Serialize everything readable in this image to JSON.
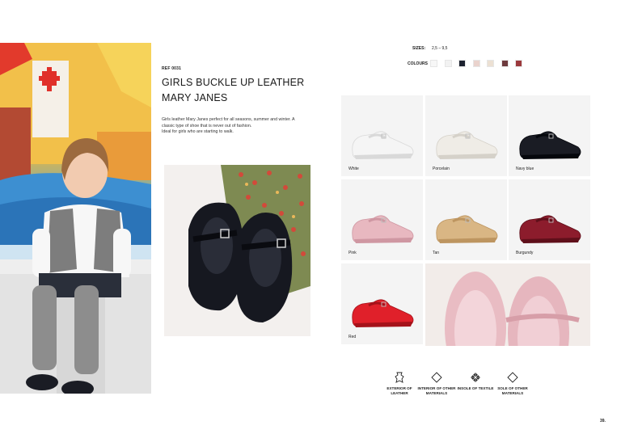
{
  "product": {
    "ref": "REF 0031",
    "title_line1": "GIRLS BUCKLE UP LEATHER",
    "title_line2": "MARY JANES",
    "description_line1": "Girls leather Mary Janes perfect for all seasons, summer and winter. A",
    "description_line2": "classic type of shoe that is never out of fashion.",
    "description_line3": "Ideal for girls who are starting to walk."
  },
  "specs": {
    "sizes_label": "SIZES:",
    "sizes_value": "2,5 – 9,5",
    "colours_label": "COLOURS",
    "swatches": [
      "#f7f7f7",
      "#f2f2f2",
      "#1d2230",
      "#ead3cd",
      "#ece0d3",
      "#6e3b3e",
      "#9c3a3d"
    ]
  },
  "variants": [
    {
      "label": "White",
      "color": "#f5f5f5",
      "shade": "#d9d9d9"
    },
    {
      "label": "Porcelain",
      "color": "#efece6",
      "shade": "#d5d1c9"
    },
    {
      "label": "Navy blue",
      "color": "#1a1c24",
      "shade": "#05070c"
    },
    {
      "label": "Pink",
      "color": "#e8b8c0",
      "shade": "#cf97a2"
    },
    {
      "label": "Tan",
      "color": "#d9b684",
      "shade": "#bd9560"
    },
    {
      "label": "Burgundy",
      "color": "#8c1c2c",
      "shade": "#5f0f1a"
    },
    {
      "label": "Red",
      "color": "#e0202a",
      "shade": "#a5121a"
    }
  ],
  "features": [
    {
      "label_line1": "EXTERIOR OF",
      "label_line2": "LEATHER",
      "icon": "leather-hide-icon"
    },
    {
      "label_line1": "INTERIOR OF OTHER",
      "label_line2": "MATERIALS",
      "icon": "diamond-outline-icon"
    },
    {
      "label_line1": "INSOLE OF TEXTILE",
      "label_line2": "",
      "icon": "textile-weave-icon"
    },
    {
      "label_line1": "SOLE OF OTHER",
      "label_line2": "MATERIALS",
      "icon": "diamond-outline-icon"
    }
  ],
  "page_number": "39."
}
